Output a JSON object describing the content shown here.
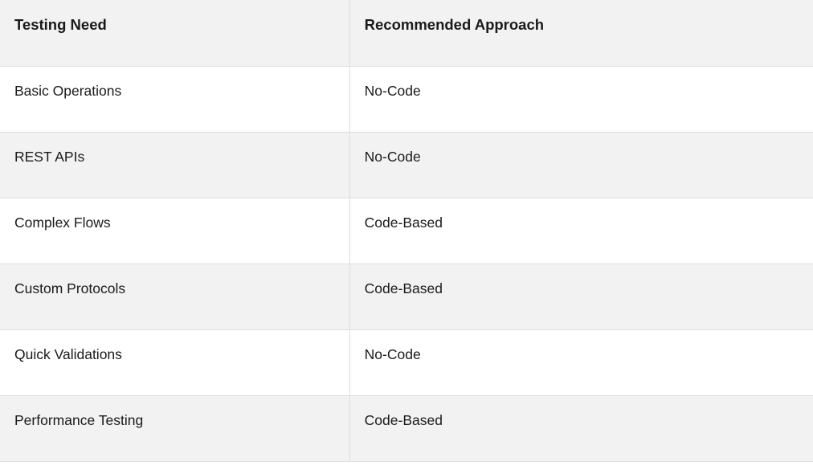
{
  "table": {
    "headers": {
      "col1": "Testing Need",
      "col2": "Recommended Approach"
    },
    "rows": [
      {
        "need": "Basic Operations",
        "approach": "No-Code"
      },
      {
        "need": "REST APIs",
        "approach": "No-Code"
      },
      {
        "need": "Complex Flows",
        "approach": "Code-Based"
      },
      {
        "need": "Custom Protocols",
        "approach": "Code-Based"
      },
      {
        "need": "Quick Validations",
        "approach": "No-Code"
      },
      {
        "need": "Performance Testing",
        "approach": "Code-Based"
      }
    ]
  }
}
